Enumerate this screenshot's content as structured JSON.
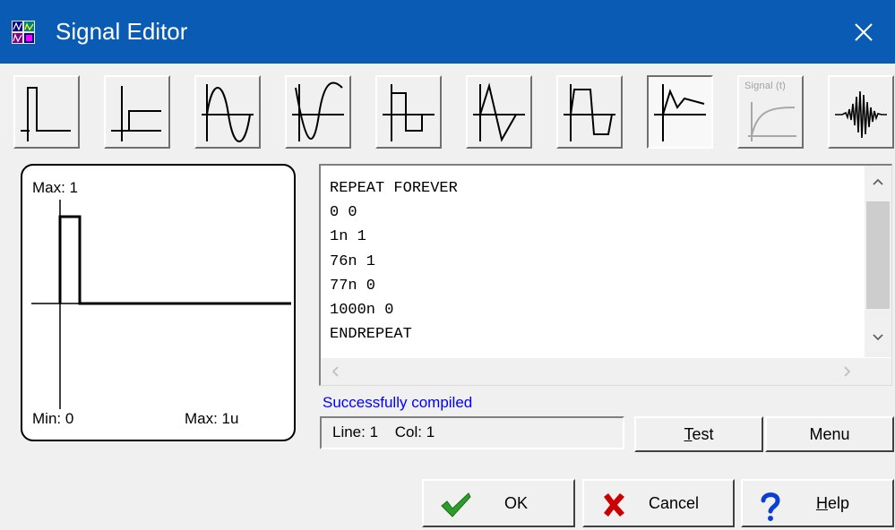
{
  "window": {
    "title": "Signal Editor",
    "close_glyph": "✕"
  },
  "toolbar": {
    "buttons": [
      {
        "name": "impulse",
        "icon": "impulse-wave-icon"
      },
      {
        "name": "step",
        "icon": "step-wave-icon"
      },
      {
        "name": "sine",
        "icon": "sine-wave-icon"
      },
      {
        "name": "inverted-sine",
        "icon": "inverted-sine-wave-icon"
      },
      {
        "name": "square",
        "icon": "square-wave-icon"
      },
      {
        "name": "triangle",
        "icon": "triangle-wave-icon"
      },
      {
        "name": "trapezoid",
        "icon": "trapezoid-wave-icon"
      },
      {
        "name": "piecewise-linear",
        "icon": "pwl-wave-icon",
        "pressed": true
      },
      {
        "name": "signal-t",
        "icon": "signal-function-icon",
        "label": "Signal (t)",
        "disabled": true
      },
      {
        "name": "noise-burst",
        "icon": "burst-wave-icon"
      }
    ]
  },
  "preview": {
    "max_y": "Max: 1",
    "min_y": "Min: 0",
    "max_x": "Max: 1u"
  },
  "editor": {
    "lines": [
      "REPEAT FOREVER",
      "0 0",
      "1n 1",
      "76n 1",
      "77n 0",
      "1000n 0",
      "ENDREPEAT"
    ]
  },
  "status": {
    "message": "Successfully compiled",
    "line": "Line: 1",
    "col": "Col: 1",
    "message_color": "#0000ff"
  },
  "buttons": {
    "test": {
      "pre": "",
      "accel": "T",
      "post": "est"
    },
    "menu": "Menu",
    "ok": "OK",
    "cancel": "Cancel",
    "help": {
      "pre": "",
      "accel": "H",
      "post": "elp"
    }
  },
  "colors": {
    "titlebar": "#0a5bb4",
    "ok_check": "#2a9d2a",
    "cancel_x": "#cc0000",
    "help_q": "#0a3fd4"
  }
}
